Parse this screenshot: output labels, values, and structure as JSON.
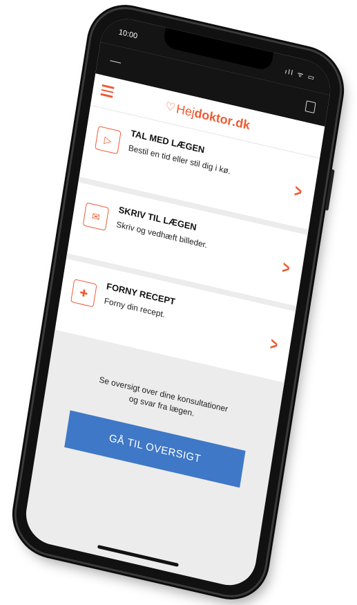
{
  "status": {
    "time": "10:00",
    "indicators": "ıll ᯤ ▭"
  },
  "apple_bar": {
    "menu_icon": "menu-icon",
    "center_icon": "apple-icon",
    "bag_icon": "bag-icon"
  },
  "header": {
    "logo_prefix": "Hej",
    "logo_bold": "doktor",
    "logo_suffix": ".dk"
  },
  "cards": [
    {
      "title": "TAL MED LÆGEN",
      "subtitle": "Bestil en tid eller stil dig i kø.",
      "icon": "video-icon"
    },
    {
      "title": "SKRIV TIL LÆGEN",
      "subtitle": "Skriv og vedhæft billeder.",
      "icon": "mail-icon"
    },
    {
      "title": "FORNY RECEPT",
      "subtitle": "Forny din recept.",
      "icon": "prescription-icon"
    }
  ],
  "overview": {
    "text_line1": "Se oversigt over dine konsultationer",
    "text_line2": "og svar fra lægen.",
    "button": "GÅ TIL OVERSIGT"
  },
  "colors": {
    "accent": "#ef5a32",
    "button": "#3f78c6",
    "screen_bg": "#ececec"
  }
}
